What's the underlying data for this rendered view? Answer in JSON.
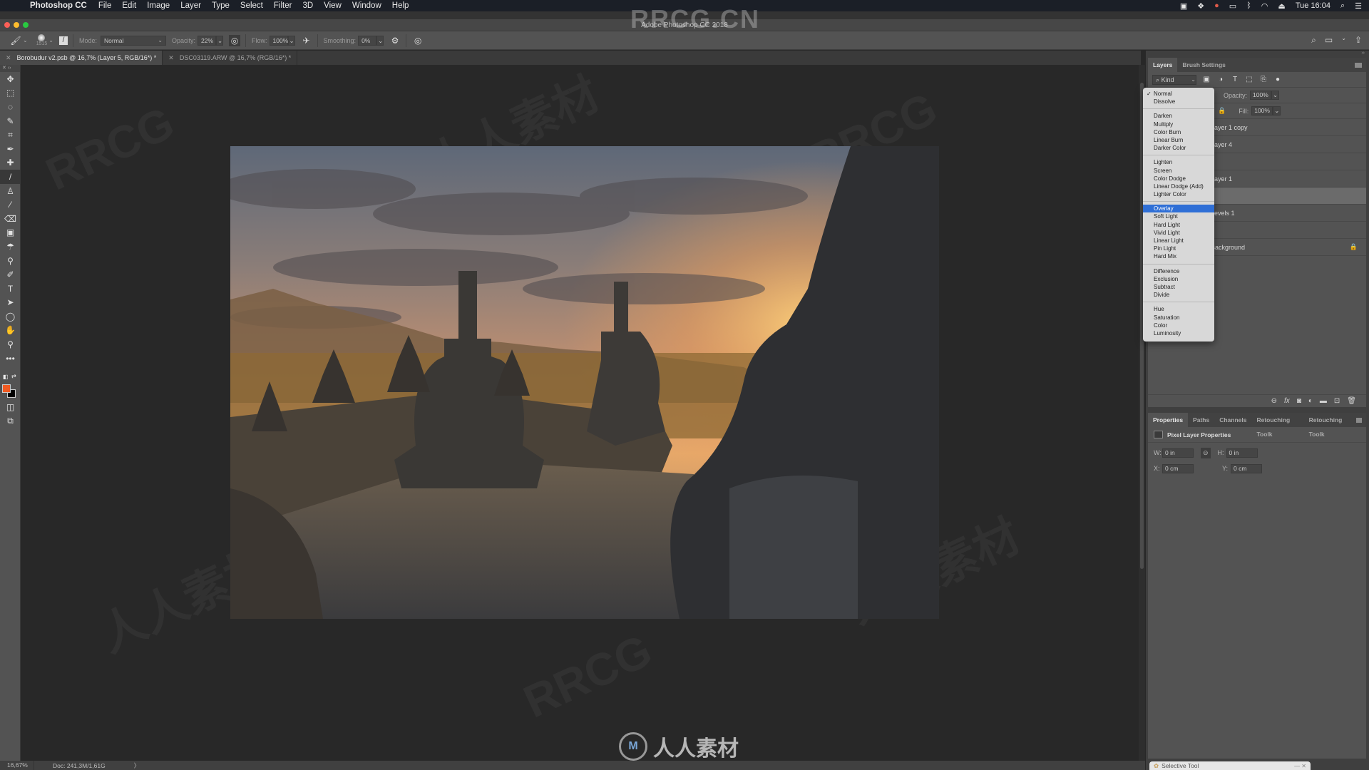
{
  "menubar": {
    "apple": "",
    "app_name": "Photoshop CC",
    "items": [
      "File",
      "Edit",
      "Image",
      "Layer",
      "Type",
      "Select",
      "Filter",
      "3D",
      "View",
      "Window",
      "Help"
    ],
    "clock": "Tue 16:04"
  },
  "window": {
    "title": "Adobe Photoshop CC 2018",
    "watermark": "RRCG.CN"
  },
  "options_bar": {
    "brush_size": "1515",
    "mode_label": "Mode:",
    "mode_value": "Normal",
    "opacity_label": "Opacity:",
    "opacity_value": "22%",
    "flow_label": "Flow:",
    "flow_value": "100%",
    "smoothing_label": "Smoothing:",
    "smoothing_value": "0%"
  },
  "doc_tabs": [
    {
      "label": "Borobudur v2.psb @ 16,7% (Layer 5, RGB/16*) *",
      "active": true
    },
    {
      "label": "DSC03119.ARW @ 16,7% (RGB/16*) *",
      "active": false
    }
  ],
  "tools": [
    "move-tool",
    "marquee-tool",
    "lasso-tool",
    "quick-selection-tool",
    "crop-tool",
    "eyedropper-tool",
    "healing-brush-tool",
    "brush-tool",
    "clone-stamp-tool",
    "history-brush-tool",
    "eraser-tool",
    "gradient-tool",
    "blur-tool",
    "dodge-tool",
    "pen-tool",
    "type-tool",
    "path-selection-tool",
    "ellipse-tool",
    "hand-tool",
    "zoom-tool",
    "edit-toolbar"
  ],
  "tool_glyphs": [
    "✥",
    "⬚",
    "◌",
    "✎",
    "⌗",
    "✒",
    "✚",
    "/",
    "♙",
    "⁄",
    "⌫",
    "▣",
    "☂",
    "⚲",
    "✐",
    "T",
    "➤",
    "◯",
    "✋",
    "⚲",
    "•••"
  ],
  "colors": {
    "foreground": "#f15a22",
    "background": "#000000",
    "selection_blue": "#2f6fd6"
  },
  "status": {
    "zoom": "16,67%",
    "doc": "Doc: 241,3M/1,61G",
    "arrow": "〉"
  },
  "layers_panel": {
    "tabs": [
      "Layers",
      "Brush Settings"
    ],
    "kind_label": "Kind",
    "opacity_label": "Opacity:",
    "opacity_value": "100%",
    "fill_label": "Fill:",
    "fill_value": "100%",
    "layers": [
      {
        "name": "Layer 1 copy",
        "selected": false
      },
      {
        "name": "Layer 4",
        "selected": false
      },
      {
        "name": "",
        "selected": false
      },
      {
        "name": "Layer 1",
        "selected": false
      },
      {
        "name": "",
        "selected": true
      },
      {
        "name": "Levels 1",
        "selected": false
      },
      {
        "name": "",
        "selected": false
      },
      {
        "name": "Background",
        "selected": false
      }
    ]
  },
  "blend_menu": {
    "groups": [
      [
        "Normal",
        "Dissolve"
      ],
      [
        "Darken",
        "Multiply",
        "Color Burn",
        "Linear Burn",
        "Darker Color"
      ],
      [
        "Lighten",
        "Screen",
        "Color Dodge",
        "Linear Dodge (Add)",
        "Lighter Color"
      ],
      [
        "Overlay",
        "Soft Light",
        "Hard Light",
        "Vivid Light",
        "Linear Light",
        "Pin Light",
        "Hard Mix"
      ],
      [
        "Difference",
        "Exclusion",
        "Subtract",
        "Divide"
      ],
      [
        "Hue",
        "Saturation",
        "Color",
        "Luminosity"
      ]
    ],
    "checked": "Normal",
    "highlighted": "Overlay"
  },
  "properties_panel": {
    "tabs": [
      "Properties",
      "Paths",
      "Channels",
      "Retouching Toolk",
      "Retouching Toolk"
    ],
    "section_title": "Pixel Layer Properties",
    "w_label": "W:",
    "w_value": "0 in",
    "h_label": "H:",
    "h_value": "0 in",
    "x_label": "X:",
    "x_value": "0 cm",
    "y_label": "Y:",
    "y_value": "0 cm"
  },
  "selective_tool": {
    "title": "Selective Tool",
    "controls": "—  ✕"
  },
  "bottom_logo": "人人素材",
  "bg_watermarks": [
    "RRCG",
    "人人素材"
  ]
}
